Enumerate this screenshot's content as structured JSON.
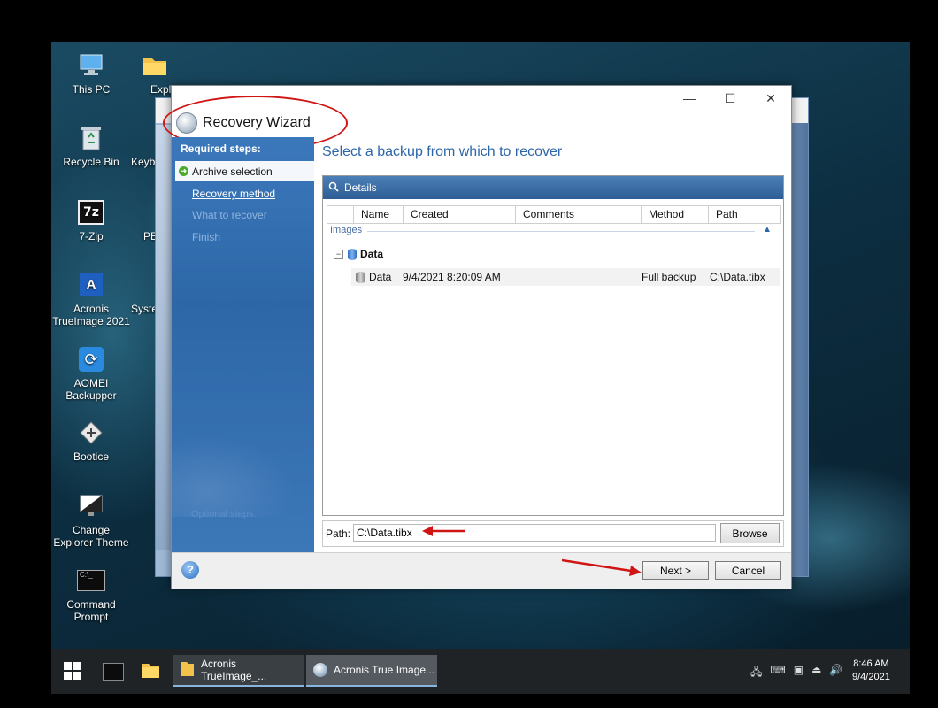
{
  "desktop": {
    "icons": [
      {
        "label": "This PC",
        "icon": "computer-icon"
      },
      {
        "label": "Explorer",
        "icon": "folder-icon"
      },
      {
        "label": "Recycle Bin",
        "icon": "recycle-bin-icon"
      },
      {
        "label": "Keyb",
        "icon": "keyboard-icon"
      },
      {
        "label": "7-Zip",
        "icon": "7zip-icon"
      },
      {
        "label": "PE",
        "icon": "pe-icon"
      },
      {
        "label": "Acronis TrueImage 2021",
        "icon": "acronis-icon"
      },
      {
        "label": "Syste",
        "icon": "system-icon"
      },
      {
        "label": "AOMEI Backupper",
        "icon": "aomei-icon"
      },
      {
        "label": "Bootice",
        "icon": "bootice-icon"
      },
      {
        "label": "Change Explorer Theme",
        "icon": "monitor-icon"
      },
      {
        "label": "Command Prompt",
        "icon": "cmd-icon"
      }
    ]
  },
  "wizard": {
    "title": "Recovery Wizard",
    "controls": {
      "minimize": "—",
      "maximize": "☐",
      "close": "✕"
    },
    "sidebar": {
      "required_header": "Required steps:",
      "steps": [
        "Archive selection",
        "Recovery method",
        "What to recover",
        "Finish"
      ],
      "optional_header": "Optional steps:"
    },
    "heading": "Select a backup from which to recover",
    "details": {
      "title": "Details",
      "columns": [
        "Name",
        "Created",
        "Comments",
        "Method",
        "Path"
      ],
      "section_label": "Images",
      "group": "Data",
      "rows": [
        {
          "name": "Data",
          "created": "9/4/2021 8:20:09 AM",
          "comments": "",
          "method": "Full backup",
          "path": "C:\\Data.tibx"
        }
      ]
    },
    "path": {
      "label": "Path:",
      "value": "C:\\Data.tibx",
      "browse": "Browse"
    },
    "buttons": {
      "next": "Next >",
      "cancel": "Cancel",
      "help": "?"
    }
  },
  "taskbar": {
    "apps": [
      {
        "label": "Acronis TrueImage_...",
        "icon": "folder-icon"
      },
      {
        "label": "Acronis True Image...",
        "icon": "acronis-disc-icon"
      }
    ],
    "clock": {
      "time": "8:46 AM",
      "date": "9/4/2021"
    }
  },
  "colors": {
    "accent": "#2c66a8",
    "sidebar": "#2d67a8",
    "annotation": "#d01515"
  }
}
